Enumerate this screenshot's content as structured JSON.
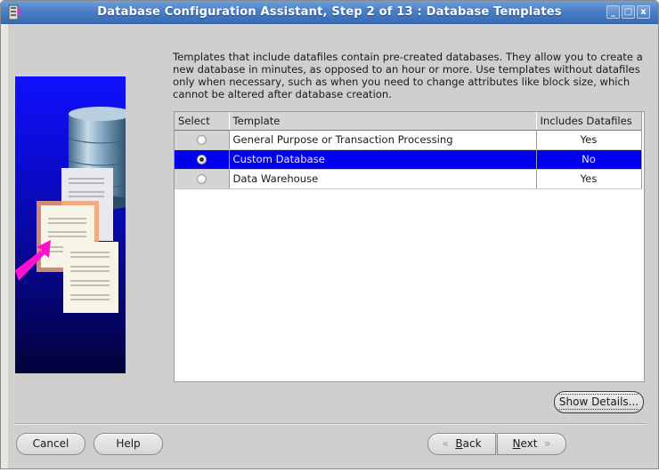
{
  "window": {
    "title": "Database Configuration Assistant, Step 2 of 13 : Database Templates",
    "controls": {
      "minimize": "_",
      "maximize": "□",
      "close": "x"
    }
  },
  "intro_text": "Templates that include datafiles contain pre-created databases. They allow you to create a new database in minutes, as opposed to an hour or more. Use templates without datafiles only when necessary, such as when you need to change attributes like block size, which cannot be altered after database creation.",
  "table": {
    "columns": [
      "Select",
      "Template",
      "Includes Datafiles"
    ],
    "rows": [
      {
        "selected": false,
        "template": "General Purpose or Transaction Processing",
        "includes_datafiles": "Yes"
      },
      {
        "selected": true,
        "template": "Custom Database",
        "includes_datafiles": "No"
      },
      {
        "selected": false,
        "template": "Data Warehouse",
        "includes_datafiles": "Yes"
      }
    ],
    "selection_color": "#0000ee"
  },
  "buttons": {
    "show_details": "Show Details...",
    "cancel": "Cancel",
    "help": "Help",
    "back": {
      "label_mnemonic": "B",
      "label_rest": "ack",
      "arrow": "«"
    },
    "next": {
      "label_mnemonic": "N",
      "label_rest": "ext",
      "arrow": "»"
    }
  },
  "colors": {
    "titlebar": "#4a7fc6",
    "dialog_bg": "#cfcfcf",
    "banner": "#0a0ac8"
  }
}
